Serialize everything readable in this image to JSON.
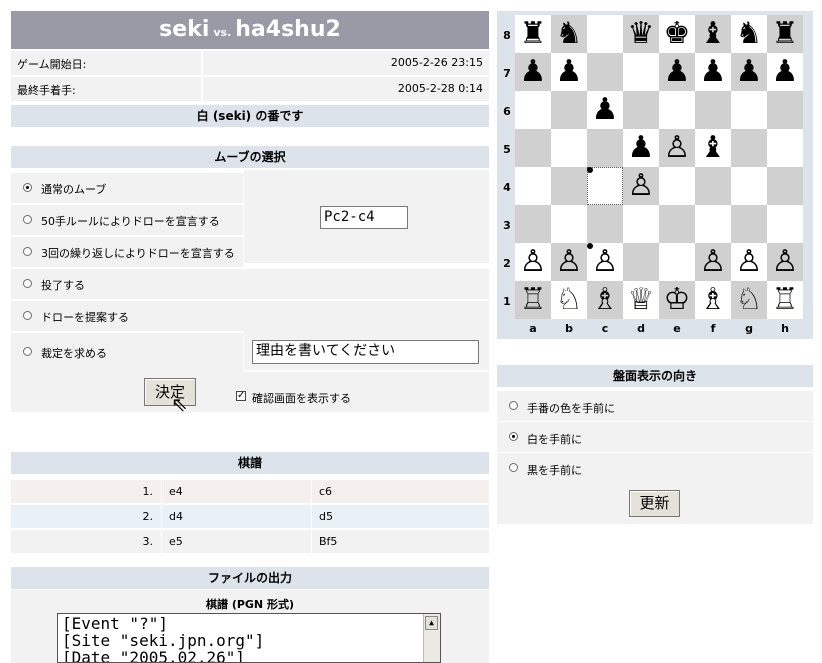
{
  "header": {
    "player_white": "seki",
    "vs": "vs.",
    "player_black": "ha4shu2"
  },
  "game_info": [
    {
      "label": "ゲーム開始日:",
      "value": "2005-2-26 23:15"
    },
    {
      "label": "最終手着手:",
      "value": "2005-2-28 0:14"
    }
  ],
  "turn_text": "白 (seki) の番です",
  "move_selection": {
    "heading": "ムーブの選択",
    "options": [
      {
        "label": "通常のムーブ",
        "checked": true
      },
      {
        "label": "50手ルールによりドローを宣言する",
        "checked": false
      },
      {
        "label": "3回の繰り返しによりドローを宣言する",
        "checked": false
      },
      {
        "label": "投了する",
        "checked": false
      },
      {
        "label": "ドローを提案する",
        "checked": false
      },
      {
        "label": "裁定を求める",
        "checked": false
      }
    ],
    "move_input_value": "Pc2-c4",
    "reason_input_value": "理由を書いてください",
    "submit_label": "決定",
    "confirm_checkbox_label": "確認画面を表示する",
    "confirm_checked": true
  },
  "kifu": {
    "heading": "棋譜",
    "moves": [
      {
        "num": "1.",
        "white": "e4",
        "black": "c6"
      },
      {
        "num": "2.",
        "white": "d4",
        "black": "d5"
      },
      {
        "num": "3.",
        "white": "e5",
        "black": "Bf5"
      }
    ]
  },
  "file_output": {
    "heading": "ファイルの出力",
    "pgn_heading": "棋譜 (PGN 形式)",
    "pgn_lines": [
      "[Event \"?\"]",
      "[Site \"seki.jpn.org\"]",
      "[Date \"2005.02.26\"]"
    ]
  },
  "board": {
    "files": [
      "a",
      "b",
      "c",
      "d",
      "e",
      "f",
      "g",
      "h"
    ],
    "ranks": [
      "8",
      "7",
      "6",
      "5",
      "4",
      "3",
      "2",
      "1"
    ],
    "rows": [
      [
        "r",
        "n",
        "",
        "q",
        "k",
        "b",
        "n",
        "r"
      ],
      [
        "p",
        "p",
        "",
        "",
        "p",
        "p",
        "p",
        "p"
      ],
      [
        "",
        "",
        "p",
        "",
        "",
        "",
        "",
        ""
      ],
      [
        "",
        "",
        "",
        "p",
        "P",
        "b",
        "",
        ""
      ],
      [
        "",
        "",
        "",
        "P",
        "",
        "",
        "",
        ""
      ],
      [
        "",
        "",
        "",
        "",
        "",
        "",
        "",
        ""
      ],
      [
        "P",
        "P",
        "P",
        "",
        "",
        "P",
        "P",
        "P"
      ],
      [
        "R",
        "N",
        "B",
        "Q",
        "K",
        "B",
        "N",
        "R"
      ]
    ],
    "selected_square": "c4",
    "marked_squares": [
      "c4",
      "c2"
    ]
  },
  "orientation": {
    "heading": "盤面表示の向き",
    "options": [
      {
        "label": "手番の色を手前に",
        "checked": false
      },
      {
        "label": "白を手前に",
        "checked": true
      },
      {
        "label": "黒を手前に",
        "checked": false
      }
    ],
    "update_label": "更新"
  }
}
